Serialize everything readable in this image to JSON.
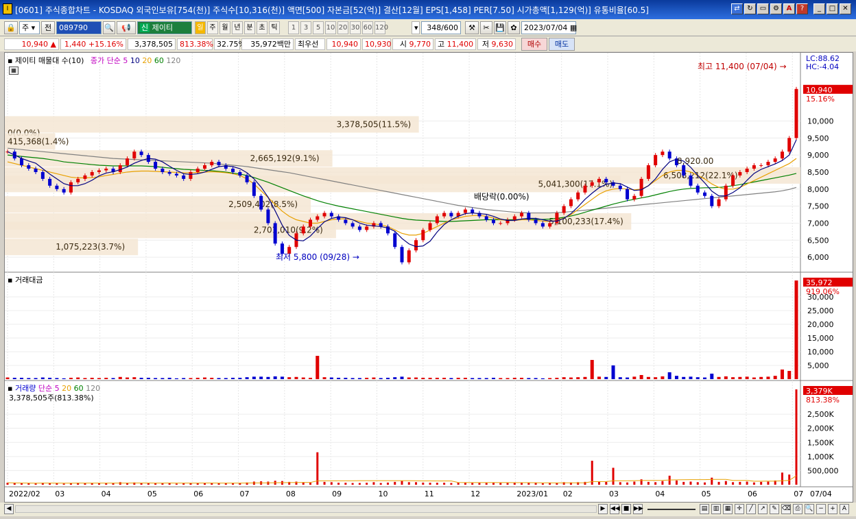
{
  "window": {
    "title": "[0601] 주식종합차트 - KOSDAQ 외국인보유[754(천)] 주식수[10,316(천)] 액면[500] 자본금[52(억)] 결산[12월] EPS[1,458] PER[7.50] 시가총액[1,129(억)] 유통비율[60.5]",
    "icon": "I"
  },
  "window_buttons": [
    "link-icon",
    "refresh-icon",
    "window-icon",
    "setup-icon",
    "alert-icon",
    "help-icon",
    "minimize-icon",
    "maximize-icon",
    "close-icon"
  ],
  "toolbar": {
    "type_select": "주",
    "prev_label": "전",
    "code": "089790",
    "stock_tag": "신",
    "stock_name": "제이티",
    "periods": [
      "일",
      "주",
      "월",
      "년",
      "분",
      "초",
      "틱"
    ],
    "intervals": [
      "1",
      "3",
      "5",
      "10",
      "20",
      "30",
      "60",
      "120"
    ],
    "count": "348",
    "count_total": "/600",
    "date": "2023/07/04"
  },
  "quote": {
    "price": "10,940",
    "arrow": "▲",
    "change": "1,440",
    "change_pct": "+15.16%",
    "volume": "3,378,505",
    "volume_ratio": "813.38%",
    "turnover": "32.75%",
    "amount": "35,972백만",
    "best_label": "최우선",
    "bid": "10,940",
    "ask": "10,930",
    "open_label": "시",
    "open": "9,770",
    "high_label": "고",
    "high": "11,400",
    "low_label": "저",
    "low": "9,630",
    "buy": "매수",
    "sell": "매도"
  },
  "price_pane": {
    "legend_name": "제이티 매물대 수(10)",
    "ma_label": "종가 단순",
    "ma_periods": [
      "5",
      "10",
      "20",
      "60",
      "120"
    ],
    "lc": "LC:88.62",
    "hc": "HC:-4.04",
    "high_note": "최고 11,400 (07/04)",
    "low_note": "최저 5,800 (09/28)",
    "dividend_note": "배당락(0.00%)",
    "current_price": "10,940",
    "current_pct": "15.16%",
    "y_ticks": [
      "10,000",
      "9,500",
      "9,000",
      "8,500",
      "8,000",
      "7,500",
      "7,000",
      "6,500",
      "6,000"
    ]
  },
  "volume_profile": [
    {
      "price": 9900,
      "label": "3,378,505(11.5%)",
      "pct": 11.5
    },
    {
      "price": 9650,
      "label": "0(0.0%)",
      "pct": 0.0
    },
    {
      "price": 9400,
      "label": "415,368(1.4%)",
      "pct": 1.4
    },
    {
      "price": 8900,
      "label": "2,665,192(9.1%)",
      "pct": 9.1
    },
    {
      "price": 8400,
      "label": "6,508,212(22.1%)",
      "pct": 22.1
    },
    {
      "price": 8150,
      "label": "5,041,300(17.1%)",
      "pct": 17.1
    },
    {
      "price": 7550,
      "label": "2,509,402(8.5%)",
      "pct": 8.5
    },
    {
      "price": 7050,
      "label": "5,100,233(17.4%)",
      "pct": 17.4
    },
    {
      "price": 6800,
      "label": "2,701,010(9.2%)",
      "pct": 9.2
    },
    {
      "price": 6300,
      "label": "1,075,223(3.7%)",
      "pct": 3.7
    }
  ],
  "dividend_price": "8,920.00",
  "amount_pane": {
    "legend": "거래대금",
    "current": "35,972",
    "pct": "919.06%",
    "y_ticks": [
      "30,000",
      "25,000",
      "20,000",
      "15,000",
      "10,000",
      "5,000"
    ]
  },
  "volume_pane": {
    "legend": "거래량",
    "ma_label": "단순",
    "ma_periods": [
      "5",
      "20",
      "60",
      "120"
    ],
    "sub": "3,378,505주(813.38%)",
    "current": "3,379K",
    "pct": "813.38%",
    "y_ticks": [
      "2,500K",
      "2,000K",
      "1,500K",
      "1,000K",
      "500,000"
    ]
  },
  "x_labels": [
    "2022/02",
    "03",
    "04",
    "05",
    "06",
    "07",
    "08",
    "09",
    "10",
    "11",
    "12",
    "2023/01",
    "02",
    "03",
    "04",
    "05",
    "06",
    "07",
    "07/04"
  ],
  "colors": {
    "up": "#e00000",
    "down": "#0000d0",
    "ma5": "#c000c0",
    "ma10": "#000080",
    "ma20": "#e8a000",
    "ma60": "#008000",
    "ma120": "#808080",
    "profile": "#f5e6d3"
  },
  "chart_data": {
    "type": "candlestick",
    "x_start": "2022-02-07",
    "x_end": "2023-07-04",
    "ylim": [
      5600,
      11600
    ],
    "close": [
      9100,
      8900,
      8700,
      8600,
      8500,
      8300,
      8100,
      8000,
      7900,
      8200,
      8300,
      8400,
      8500,
      8550,
      8600,
      8500,
      8700,
      8900,
      9100,
      9000,
      8800,
      8600,
      8500,
      8450,
      8400,
      8300,
      8500,
      8600,
      8700,
      8800,
      8700,
      8600,
      8500,
      8400,
      8200,
      7800,
      7400,
      7000,
      6400,
      6100,
      6300,
      6700,
      6900,
      7100,
      7200,
      7300,
      7200,
      7100,
      7000,
      6900,
      6800,
      6900,
      7000,
      6900,
      6700,
      6300,
      5850,
      6200,
      6500,
      6800,
      7000,
      7200,
      7300,
      7200,
      7300,
      7400,
      7300,
      7200,
      7100,
      7000,
      7000,
      7100,
      7200,
      7300,
      7100,
      7000,
      6900,
      7000,
      7300,
      7500,
      7700,
      7900,
      8100,
      8200,
      8300,
      8200,
      8100,
      8000,
      7700,
      7800,
      8300,
      8700,
      9000,
      9100,
      8900,
      8700,
      8400,
      8100,
      7900,
      7800,
      7500,
      7700,
      8100,
      8400,
      8500,
      8600,
      8700,
      8700,
      8800,
      8900,
      9100,
      9500,
      10940
    ],
    "ma20": [
      8800,
      8750,
      8700,
      8650,
      8600,
      8550,
      8500,
      8450,
      8400,
      8350,
      8330,
      8330,
      8340,
      8360,
      8400,
      8430,
      8470,
      8500,
      8520,
      8530,
      8530,
      8520,
      8510,
      8500,
      8490,
      8480,
      8480,
      8490,
      8500,
      8510,
      8500,
      8480,
      8450,
      8400,
      8300,
      8150,
      7950,
      7750,
      7550,
      7350,
      7200,
      7100,
      7050,
      7000,
      7000,
      7050,
      7100,
      7120,
      7130,
      7100,
      7050,
      7000,
      6980,
      6950,
      6900,
      6800,
      6700,
      6650,
      6650,
      6700,
      6800,
      6900,
      7000,
      7100,
      7150,
      7200,
      7220,
      7230,
      7200,
      7150,
      7100,
      7080,
      7080,
      7100,
      7100,
      7080,
      7060,
      7050,
      7080,
      7150,
      7250,
      7400,
      7550,
      7700,
      7850,
      7950,
      8000,
      8020,
      8000,
      7980,
      8000,
      8100,
      8250,
      8400,
      8500,
      8550,
      8550,
      8500,
      8400,
      8300,
      8150,
      8050,
      8000,
      8000,
      8050,
      8150,
      8250,
      8350,
      8450,
      8550,
      8650,
      8750,
      8900
    ],
    "ma60": [
      9000,
      8980,
      8960,
      8940,
      8920,
      8900,
      8870,
      8840,
      8800,
      8780,
      8760,
      8740,
      8720,
      8700,
      8690,
      8680,
      8680,
      8680,
      8680,
      8680,
      8670,
      8660,
      8640,
      8620,
      8600,
      8580,
      8570,
      8560,
      8550,
      8540,
      8520,
      8500,
      8470,
      8440,
      8400,
      8340,
      8270,
      8200,
      8120,
      8040,
      7960,
      7880,
      7800,
      7730,
      7660,
      7600,
      7550,
      7500,
      7460,
      7420,
      7380,
      7340,
      7300,
      7260,
      7220,
      7180,
      7140,
      7110,
      7090,
      7080,
      7070,
      7060,
      7050,
      7050,
      7060,
      7070,
      7080,
      7090,
      7100,
      7100,
      7100,
      7100,
      7100,
      7110,
      7110,
      7110,
      7110,
      7120,
      7140,
      7170,
      7210,
      7260,
      7320,
      7380,
      7440,
      7500,
      7560,
      7610,
      7660,
      7700,
      7740,
      7780,
      7830,
      7880,
      7930,
      7970,
      8000,
      8020,
      8030,
      8040,
      8040,
      8050,
      8070,
      8100,
      8130,
      8170,
      8210,
      8250,
      8290,
      8330,
      8370,
      8410,
      8460
    ],
    "ma120": [
      9200,
      9180,
      9160,
      9140,
      9120,
      9100,
      9080,
      9060,
      9040,
      9020,
      9000,
      8980,
      8960,
      8940,
      8920,
      8900,
      8890,
      8880,
      8870,
      8860,
      8850,
      8840,
      8830,
      8820,
      8810,
      8800,
      8790,
      8780,
      8770,
      8760,
      8740,
      8720,
      8700,
      8680,
      8660,
      8630,
      8600,
      8570,
      8540,
      8510,
      8480,
      8440,
      8400,
      8360,
      8320,
      8280,
      8240,
      8200,
      8160,
      8120,
      8080,
      8040,
      8000,
      7960,
      7920,
      7880,
      7840,
      7800,
      7760,
      7720,
      7680,
      7640,
      7600,
      7560,
      7520,
      7490,
      7460,
      7430,
      7400,
      7380,
      7360,
      7340,
      7320,
      7310,
      7300,
      7300,
      7300,
      7300,
      7310,
      7320,
      7340,
      7360,
      7380,
      7400,
      7420,
      7440,
      7460,
      7480,
      7500,
      7520,
      7540,
      7560,
      7580,
      7600,
      7620,
      7640,
      7660,
      7680,
      7700,
      7720,
      7740,
      7760,
      7780,
      7800,
      7820,
      7840,
      7860,
      7880,
      7900,
      7920,
      7950,
      7990,
      8050
    ],
    "amount": [
      600,
      500,
      500,
      400,
      400,
      600,
      500,
      400,
      300,
      500,
      600,
      400,
      500,
      400,
      500,
      400,
      800,
      600,
      700,
      500,
      500,
      400,
      400,
      500,
      300,
      400,
      400,
      500,
      600,
      500,
      400,
      400,
      500,
      500,
      700,
      900,
      900,
      800,
      1000,
      900,
      700,
      800,
      600,
      500,
      8500,
      700,
      600,
      500,
      500,
      400,
      400,
      500,
      600,
      400,
      500,
      700,
      900,
      600,
      600,
      500,
      500,
      500,
      500,
      400,
      500,
      500,
      400,
      400,
      400,
      500,
      400,
      400,
      500,
      500,
      400,
      400,
      300,
      400,
      500,
      700,
      600,
      700,
      800,
      7000,
      900,
      800,
      5000,
      700,
      600,
      900,
      1500,
      800,
      700,
      1000,
      2500,
      1200,
      800,
      900,
      700,
      600,
      2000,
      800,
      1000,
      700,
      800,
      900,
      600,
      800,
      900,
      1200,
      3500,
      3000,
      35972
    ],
    "volume": [
      70,
      60,
      55,
      50,
      45,
      70,
      60,
      50,
      40,
      60,
      70,
      50,
      60,
      50,
      60,
      50,
      90,
      70,
      80,
      60,
      60,
      50,
      50,
      60,
      40,
      50,
      50,
      60,
      70,
      60,
      50,
      50,
      60,
      60,
      80,
      110,
      120,
      110,
      140,
      130,
      100,
      110,
      90,
      70,
      1150,
      100,
      90,
      70,
      70,
      60,
      60,
      70,
      90,
      60,
      75,
      100,
      130,
      90,
      90,
      75,
      70,
      70,
      70,
      60,
      70,
      70,
      60,
      60,
      60,
      70,
      60,
      60,
      70,
      70,
      60,
      60,
      50,
      60,
      70,
      90,
      80,
      90,
      100,
      850,
      110,
      100,
      600,
      90,
      80,
      110,
      190,
      100,
      90,
      130,
      320,
      150,
      100,
      110,
      90,
      80,
      250,
      100,
      130,
      90,
      100,
      110,
      80,
      100,
      110,
      150,
      430,
      360,
      3379
    ]
  }
}
